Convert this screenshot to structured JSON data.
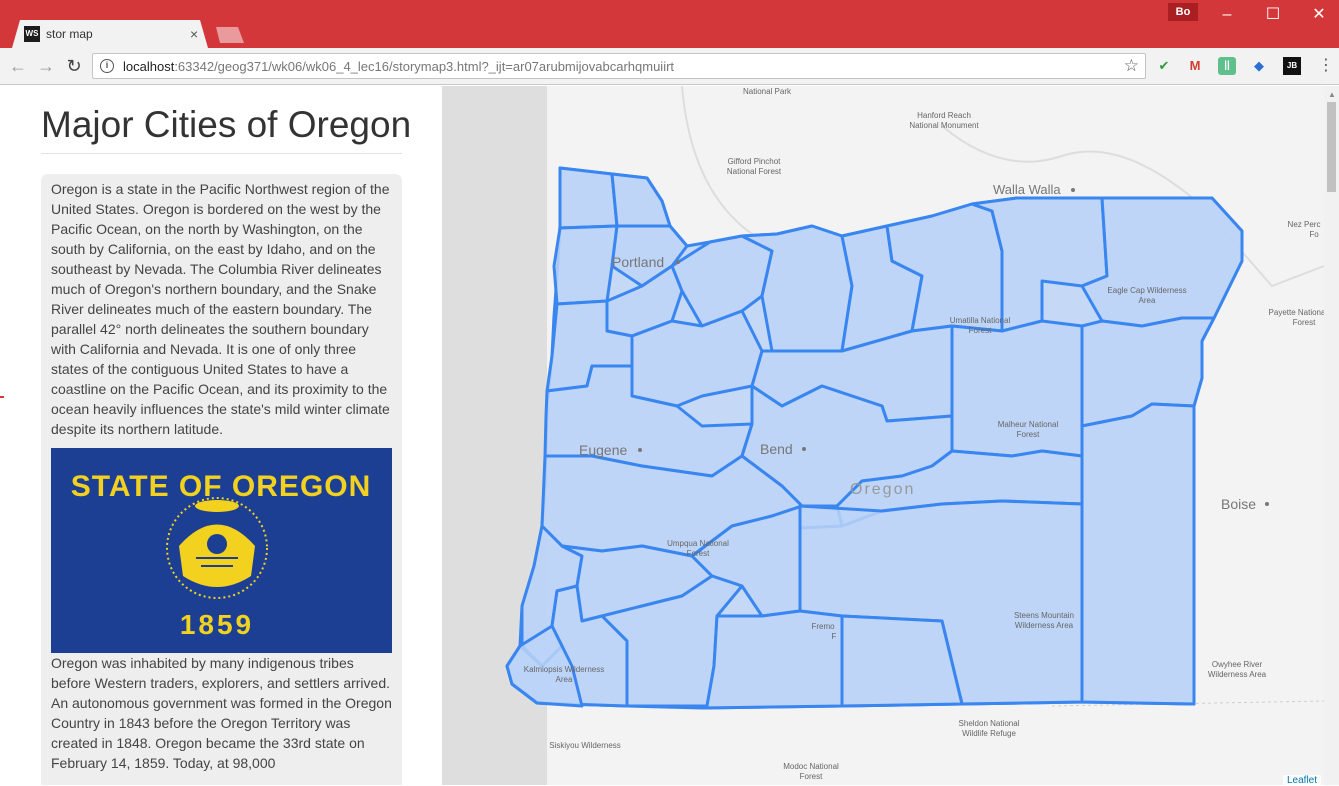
{
  "browser": {
    "tab_title": "stor map",
    "tab_icon": "WS",
    "profile": "Bo",
    "url_host": "localhost",
    "url_rest": ":63342/geog371/wk06/wk06_4_lec16/storymap3.html?_ijt=ar07arubmijovabcarhqmuiirt",
    "extensions": [
      "check-extension-icon",
      "gmail-icon",
      "extension-icon",
      "extension-blue-icon",
      "jetbrains-icon"
    ]
  },
  "sidebar": {
    "title": "Major Cities of Oregon",
    "paragraph1": "Oregon is a state in the Pacific Northwest region of the United States. Oregon is bordered on the west by the Pacific Ocean, on the north by Washington, on the south by California, on the east by Idaho, and on the southeast by Nevada. The Columbia River delineates much of Oregon's northern boundary, and the Snake River delineates much of the eastern boundary. The parallel 42° north delineates the southern boundary with California and Nevada. It is one of only three states of the contiguous United States to have a coastline on the Pacific Ocean, and its proximity to the ocean heavily influences the state's mild winter climate despite its northern latitude.",
    "flag_text_top": "STATE OF OREGON",
    "flag_text_bottom": "1859",
    "paragraph2": "Oregon was inhabited by many indigenous tribes before Western traders, explorers, and settlers arrived. An autonomous government was formed in the Oregon Country in 1843 before the Oregon Territory was created in 1848. Oregon became the 33rd state on February 14, 1859. Today, at 98,000"
  },
  "map": {
    "cities": [
      "Portland",
      "Eugene",
      "Bend",
      "Walla Walla",
      "Boise"
    ],
    "state_label": "Oregon",
    "places": {
      "national_park": "National Park",
      "hanford": "Hanford Reach\nNational Monument",
      "gifford": "Gifford Pinchot\nNational Forest",
      "nez_perce": "Nez Perc\nFo",
      "eagle_cap": "Eagle Cap Wilderness\nArea",
      "payette": "Payette Nationa\nForest",
      "umatilla": "Umatilla National\nForest",
      "malheur": "Malheur National\nForest",
      "umpqua": "Umpqua National\nForest",
      "fremont": "Fremo\nF",
      "steens": "Steens Mountain\nWilderness Area",
      "kalmiopsis": "Kalmiopsis Wilderness\nArea",
      "owyhee": "Owyhee River\nWilderness Area",
      "sheldon": "Sheldon National\nWildlife Refuge",
      "siskiyou": "Siskiyou Wilderness",
      "modoc": "Modoc National\nForest"
    },
    "attribution": "Leaflet",
    "fill_color": "#bcd3f7",
    "stroke_color": "#3a86f0"
  }
}
